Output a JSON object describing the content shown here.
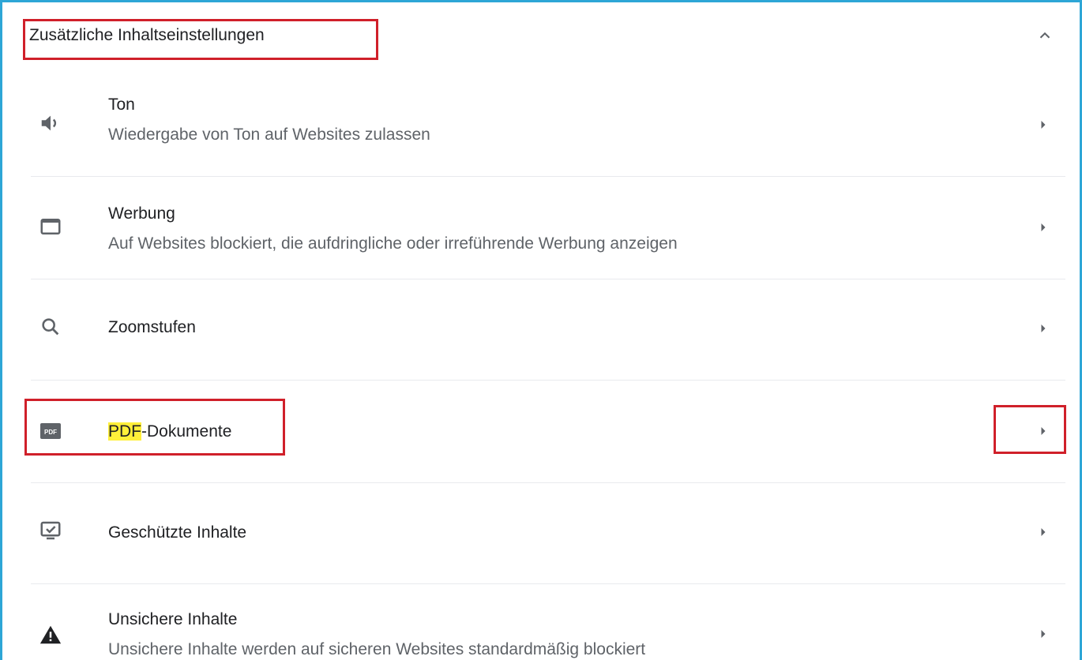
{
  "section": {
    "title": "Zusätzliche Inhaltseinstellungen"
  },
  "rows": [
    {
      "title": "Ton",
      "subtitle": "Wiedergabe von Ton auf Websites zulassen",
      "icon": "speaker-icon"
    },
    {
      "title": "Werbung",
      "subtitle": "Auf Websites blockiert, die aufdringliche oder irreführende Werbung anzeigen",
      "icon": "window-icon"
    },
    {
      "title": "Zoomstufen",
      "subtitle": "",
      "icon": "search-icon"
    },
    {
      "title_highlight": "PDF",
      "title_rest": "-Dokumente",
      "subtitle": "",
      "icon": "pdf-icon"
    },
    {
      "title": "Geschützte Inhalte",
      "subtitle": "",
      "icon": "protected-content-icon"
    },
    {
      "title": "Unsichere Inhalte",
      "subtitle": "Unsichere Inhalte werden auf sicheren Websites standardmäßig blockiert",
      "icon": "warning-icon"
    }
  ],
  "icons": {
    "pdf_label": "PDF"
  },
  "colors": {
    "frame_border": "#2ea6d6",
    "annotation_red": "#d0202a",
    "search_highlight": "#ffef3a",
    "icon_gray": "#5f6368"
  }
}
